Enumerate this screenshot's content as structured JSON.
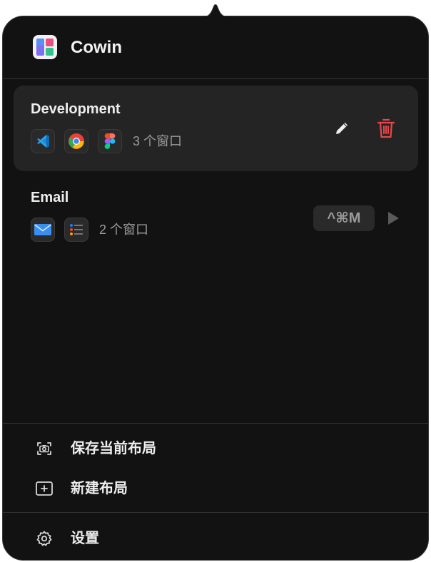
{
  "app": {
    "title": "Cowin",
    "icon": "cowin-app-icon"
  },
  "layouts": [
    {
      "name": "Development",
      "selected": true,
      "apps": [
        "vscode-icon",
        "chrome-icon",
        "figma-icon"
      ],
      "window_count": "3 个窗口",
      "actions": [
        "edit-icon",
        "trash-icon"
      ]
    },
    {
      "name": "Email",
      "selected": false,
      "apps": [
        "mail-icon",
        "reminders-icon"
      ],
      "window_count": "2 个窗口",
      "shortcut": "^⌘M",
      "actions": [
        "play-icon"
      ]
    }
  ],
  "menu": {
    "save_layout": "保存当前布局",
    "new_layout": "新建布局",
    "settings": "设置"
  },
  "colors": {
    "background": "#121212",
    "selected_card": "#242424",
    "delete": "#e8474b",
    "text": "#eeeeee",
    "muted_text": "#9a9a9a"
  }
}
